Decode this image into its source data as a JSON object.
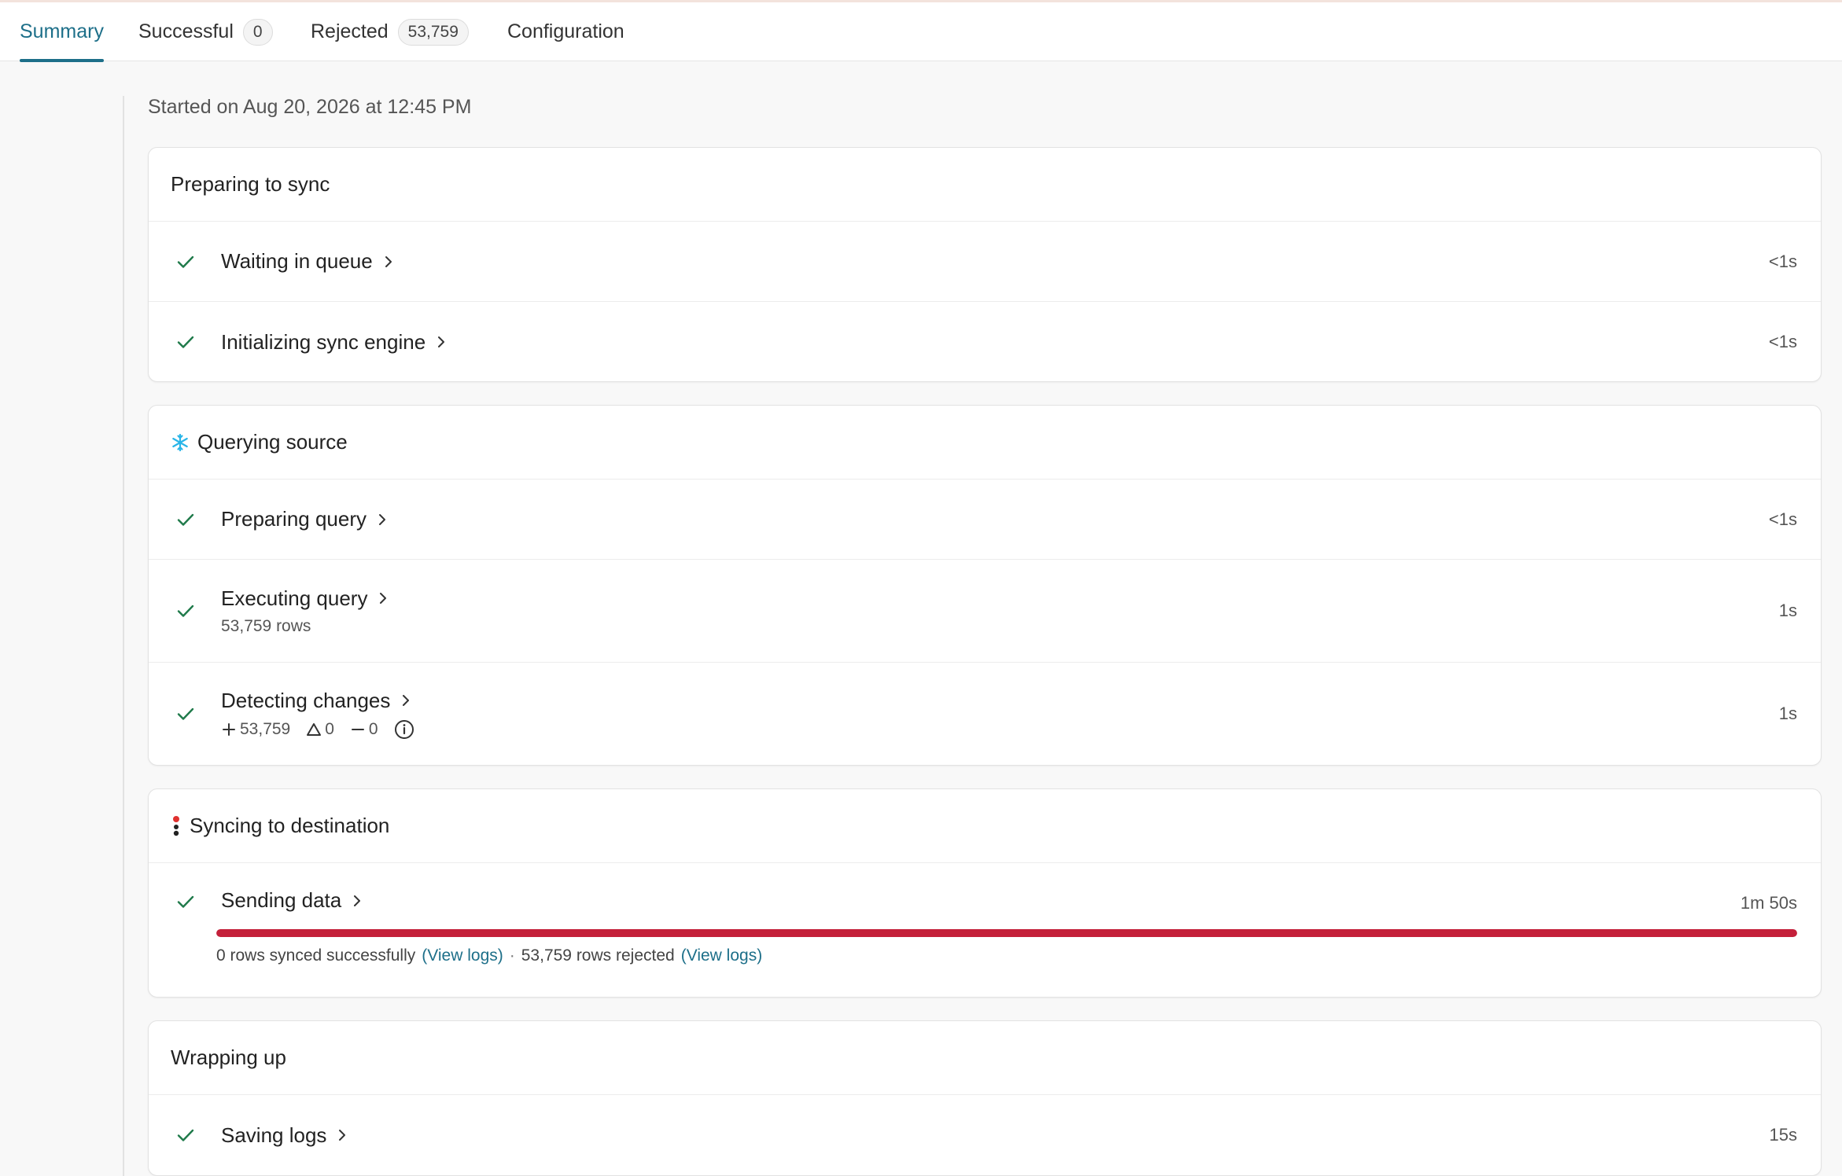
{
  "tabs": [
    {
      "label": "Summary",
      "active": true
    },
    {
      "label": "Successful",
      "count": "0"
    },
    {
      "label": "Rejected",
      "count": "53,759"
    },
    {
      "label": "Configuration"
    }
  ],
  "started_text": "Started on Aug 20, 2026 at 12:45 PM",
  "sections": {
    "preparing": {
      "title": "Preparing to sync",
      "steps": [
        {
          "label": "Waiting in queue",
          "duration": "<1s"
        },
        {
          "label": "Initializing sync engine",
          "duration": "<1s"
        }
      ]
    },
    "querying": {
      "title": "Querying source",
      "icon": "snowflake-icon",
      "steps": [
        {
          "label": "Preparing query",
          "duration": "<1s"
        },
        {
          "label": "Executing query",
          "sub": "53,759 rows",
          "duration": "1s"
        },
        {
          "label": "Detecting changes",
          "duration": "1s",
          "diff": {
            "added": "53,759",
            "changed": "0",
            "removed": "0"
          }
        }
      ]
    },
    "syncing": {
      "title": "Syncing to destination",
      "icon": "destination-icon",
      "steps": [
        {
          "label": "Sending data",
          "duration": "1m 50s",
          "progress": 1.0,
          "summary": {
            "success_text": "0 rows synced successfully",
            "success_link": "(View logs)",
            "separator": "·",
            "rejected_text": "53,759 rows rejected",
            "rejected_link": "(View logs)"
          }
        }
      ]
    },
    "wrapping": {
      "title": "Wrapping up",
      "steps": [
        {
          "label": "Saving logs",
          "duration": "15s"
        }
      ]
    }
  },
  "colors": {
    "accent": "#1d6f89",
    "check": "#1f7a4a",
    "rejected_bar": "#c4203a",
    "snowflake": "#29b5e8"
  }
}
